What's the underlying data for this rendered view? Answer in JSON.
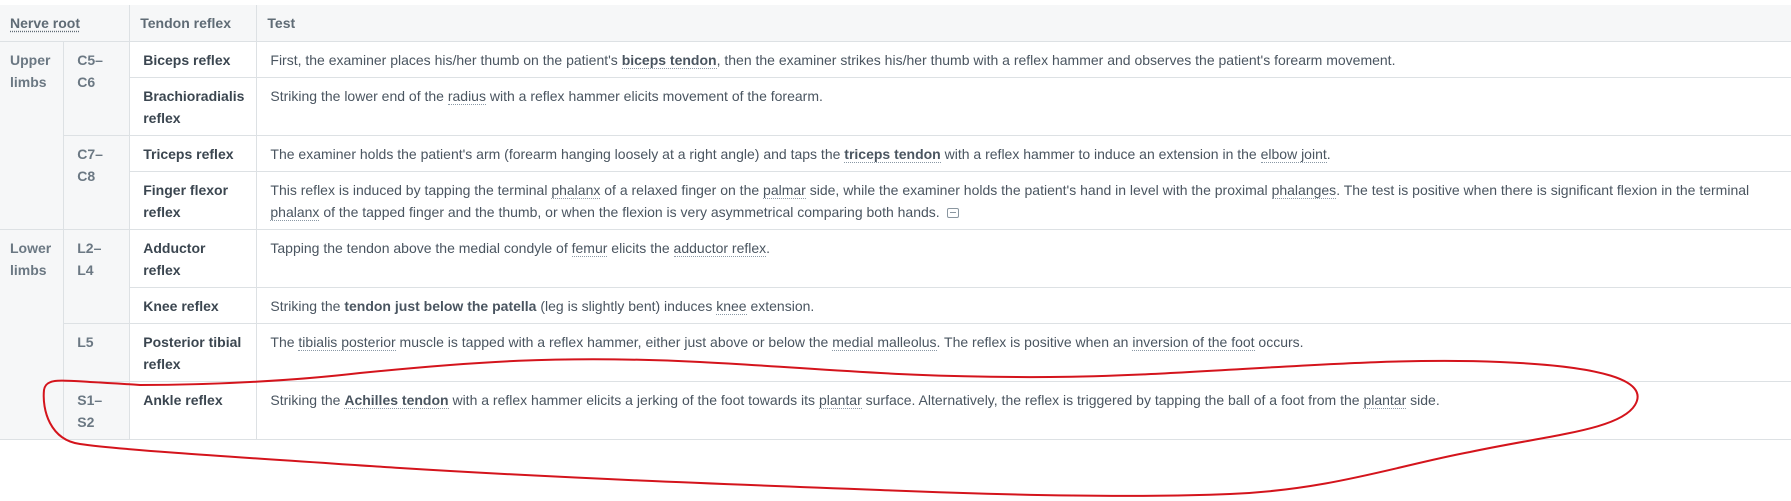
{
  "headers": {
    "nerve_root": "Nerve root",
    "tendon_reflex": "Tendon reflex",
    "test": "Test"
  },
  "regions": {
    "upper": "Upper limbs",
    "lower": "Lower limbs"
  },
  "roots": {
    "c5c6": "C5–C6",
    "c7c8": "C7–C8",
    "l2l4": "L2–L4",
    "l5": "L5",
    "s1s2": "S1–S2"
  },
  "rows": [
    {
      "reflex": "Biceps reflex",
      "test": [
        "First, the examiner places his/her thumb on the patient's ",
        "biceps tendon",
        ", then the examiner strikes his/her thumb with a reflex hammer and observes the patient's forearm movement."
      ]
    },
    {
      "reflex": "Brachioradialis reflex",
      "test": [
        "Striking the lower end of the ",
        "radius",
        " with a reflex hammer elicits movement of the forearm."
      ]
    },
    {
      "reflex": "Triceps reflex",
      "test": [
        "The examiner holds the patient's arm (forearm hanging loosely at a right angle) and taps the ",
        "triceps tendon",
        " with a reflex hammer to induce an extension in the ",
        "elbow joint",
        "."
      ]
    },
    {
      "reflex": "Finger flexor reflex",
      "test": [
        "This reflex is induced by tapping the terminal ",
        "phalanx",
        " of a relaxed finger on the ",
        "palmar",
        " side, while the examiner holds the patient's hand in level with the proximal ",
        "phalanges",
        ". The test is positive when there is significant flexion in the terminal ",
        "phalanx",
        " of the tapped finger and the thumb, or when the flexion is very asymmetrical comparing both hands."
      ]
    },
    {
      "reflex": "Adductor reflex",
      "test": [
        "Tapping the tendon above the medial condyle of ",
        "femur",
        " elicits the ",
        "adductor reflex",
        "."
      ]
    },
    {
      "reflex": "Knee reflex",
      "test": [
        "Striking the ",
        "tendon just below the patella",
        " (leg is slightly bent) induces ",
        "knee",
        " extension."
      ]
    },
    {
      "reflex": "Posterior tibial reflex",
      "test": [
        "The ",
        "tibialis posterior",
        " muscle is tapped with a reflex hammer, either just above or below the ",
        "medial malleolus",
        ". The reflex is positive when an ",
        "inversion of the foot",
        " occurs."
      ]
    },
    {
      "reflex": "Ankle reflex",
      "test": [
        "Striking the ",
        "Achilles tendon",
        " with a reflex hammer elicits a jerking of the foot towards its ",
        "plantar",
        " surface. Alternatively, the reflex is triggered by tapping the ball of a foot from the ",
        "plantar",
        " side."
      ]
    }
  ],
  "icons": {
    "note": "note-icon"
  },
  "colors": {
    "annotation": "#d4141c"
  }
}
